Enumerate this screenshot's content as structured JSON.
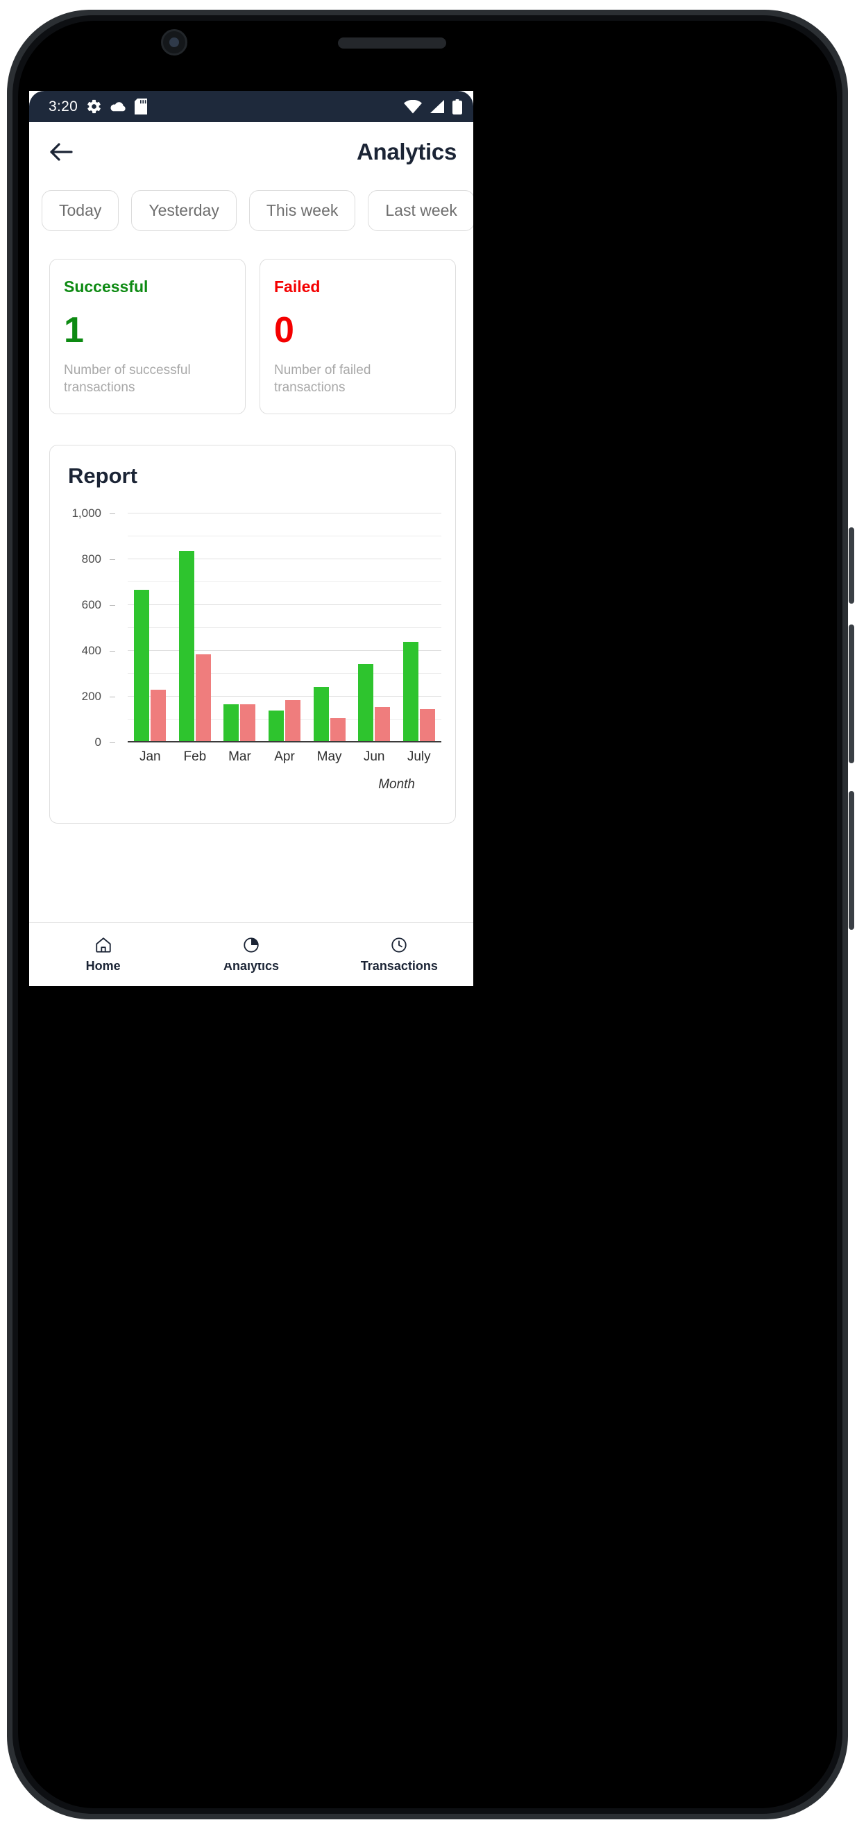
{
  "status_bar": {
    "time": "3:20",
    "left_icons": [
      "gear-icon",
      "cloud-icon",
      "sd-card-icon"
    ],
    "right_icons": [
      "wifi-icon",
      "cellular-signal-icon",
      "battery-icon"
    ],
    "background_color": "#1e293b"
  },
  "header": {
    "back_icon": "arrow-left-icon",
    "title": "Analytics"
  },
  "filters": {
    "chips": [
      {
        "label": "Today"
      },
      {
        "label": "Yesterday"
      },
      {
        "label": "This week"
      },
      {
        "label": "Last week"
      }
    ]
  },
  "stats": {
    "successful": {
      "title": "Successful",
      "value": "1",
      "description": "Number of successful transactions",
      "color": "#0d8a12"
    },
    "failed": {
      "title": "Failed",
      "value": "0",
      "description": "Number of failed transactions",
      "color": "#f40000"
    }
  },
  "report": {
    "title": "Report"
  },
  "chart_data": {
    "type": "bar",
    "title": "Report",
    "xlabel": "Month",
    "ylabel": "",
    "categories": [
      "Jan",
      "Feb",
      "Mar",
      "Apr",
      "May",
      "Jun",
      "July"
    ],
    "series": [
      {
        "name": "Successful",
        "color": "#2ec42e",
        "values": [
          660,
          830,
          160,
          135,
          238,
          337,
          435
        ]
      },
      {
        "name": "Failed",
        "color": "#ef7d7d",
        "values": [
          225,
          380,
          160,
          178,
          100,
          148,
          140
        ]
      }
    ],
    "ylim": [
      0,
      1000
    ],
    "ytick_labels": [
      "0",
      "200",
      "400",
      "600",
      "800",
      "1,000"
    ],
    "ytick_values": [
      0,
      200,
      400,
      600,
      800,
      1000
    ],
    "minor_gridline_values": [
      100,
      300,
      500,
      700,
      900
    ],
    "grid": true,
    "legend": "none"
  },
  "bottom_nav": {
    "items": [
      {
        "label": "Home",
        "icon": "home-icon"
      },
      {
        "label": "Analytics",
        "icon": "pie-chart-icon"
      },
      {
        "label": "Transactions",
        "icon": "clock-icon"
      }
    ]
  }
}
